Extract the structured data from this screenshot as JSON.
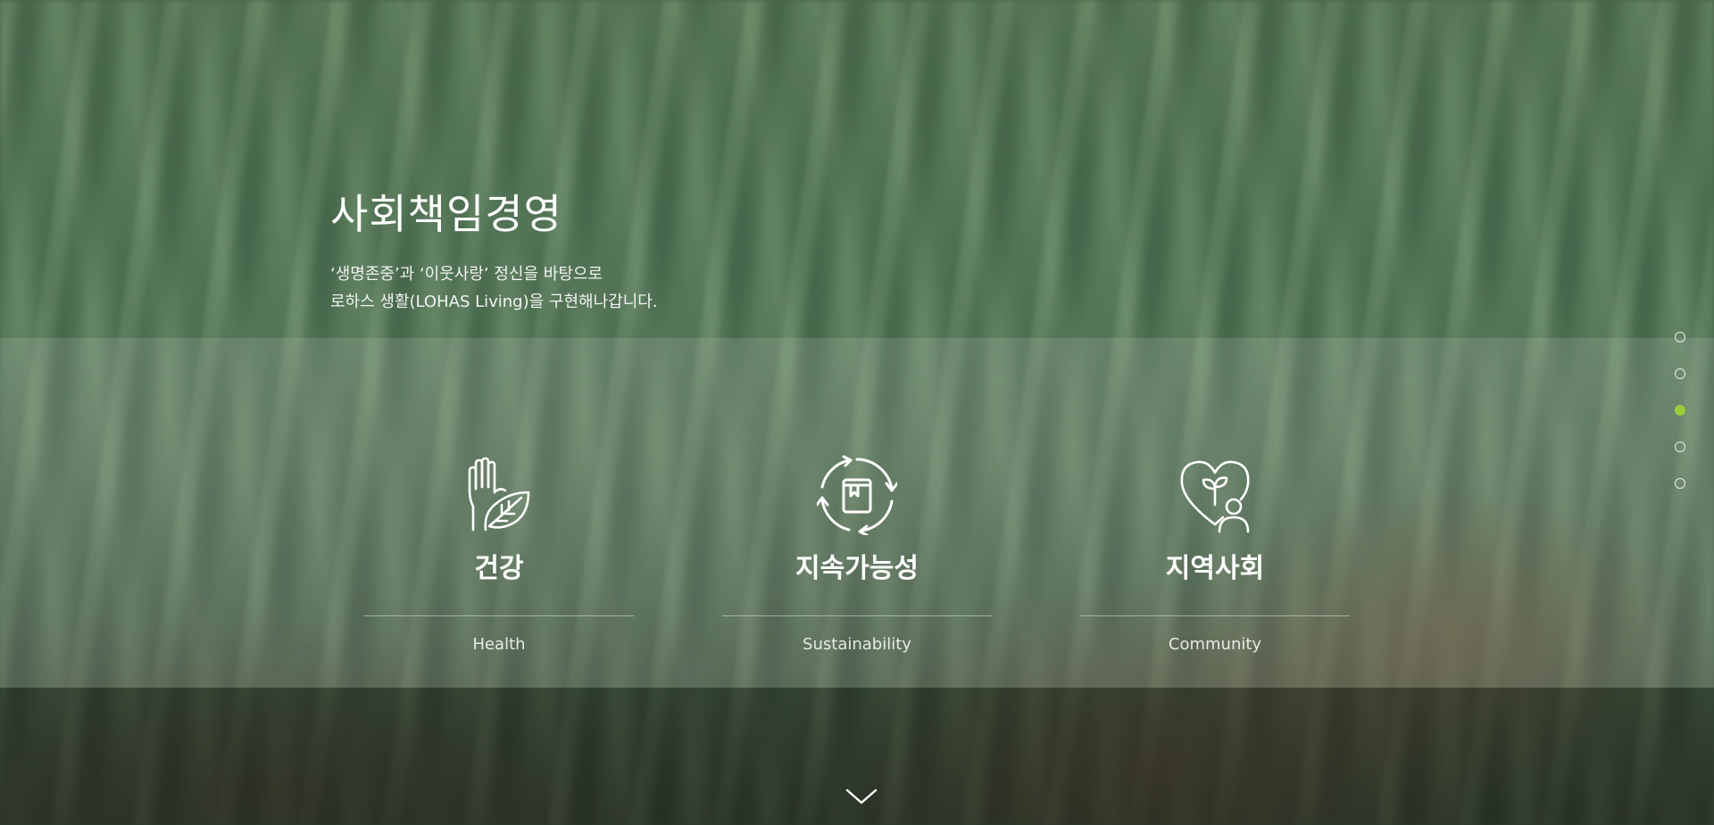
{
  "section": {
    "title": "사회책임경영",
    "description_line1": "‘생명존중’과 ‘이웃사랑’ 정신을 바탕으로",
    "description_line2": "로하스 생활(LOHAS Living)을 구현해나갑니다."
  },
  "pillars": [
    {
      "title": "건강",
      "subtitle": "Health",
      "icon": "hand-leaf-icon"
    },
    {
      "title": "지속가능성",
      "subtitle": "Sustainability",
      "icon": "recycle-box-icon"
    },
    {
      "title": "지역사회",
      "subtitle": "Community",
      "icon": "heart-sprout-person-icon"
    }
  ],
  "pagination": {
    "count": 5,
    "active_index": 2,
    "active_color": "#9dcc3a"
  },
  "scroll_icon": "chevron-down-icon"
}
